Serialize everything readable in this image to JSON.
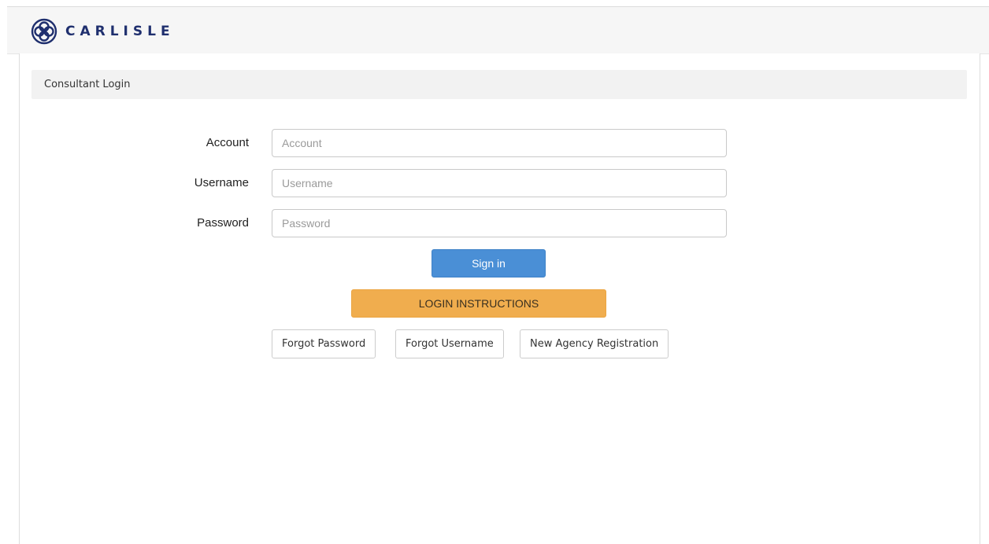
{
  "header": {
    "brand": "CARLISLE",
    "logo_icon": "carlisle-quatrefoil-logo",
    "brand_color": "#1f2f6e"
  },
  "panel": {
    "title": "Consultant Login"
  },
  "form": {
    "fields": [
      {
        "label": "Account",
        "placeholder": "Account",
        "value": ""
      },
      {
        "label": "Username",
        "placeholder": "Username",
        "value": ""
      },
      {
        "label": "Password",
        "placeholder": "Password",
        "value": ""
      }
    ],
    "sign_in_label": "Sign in",
    "sign_in_color": "#4a8fd6",
    "login_instructions_label": "LOGIN INSTRUCTIONS",
    "login_instructions_color": "#f0ad4e",
    "links": [
      {
        "label": "Forgot Password"
      },
      {
        "label": "Forgot Username"
      },
      {
        "label": "New Agency Registration"
      }
    ]
  }
}
